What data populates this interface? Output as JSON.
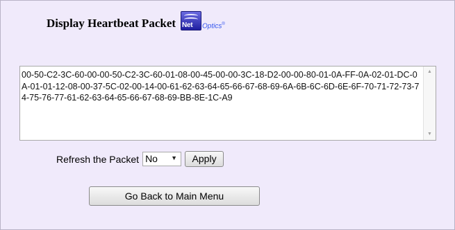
{
  "header": {
    "title": "Display Heartbeat Packet",
    "logo": {
      "mark_text": "Net",
      "tagline": "Optics",
      "registered": "®",
      "brand_color": "#2a2ab8"
    }
  },
  "packet": {
    "hex": "00-50-C2-3C-60-00-00-50-C2-3C-60-01-08-00-45-00-00-3C-18-D2-00-00-80-01-0A-FF-0A-02-01-DC-0A-01-01-12-08-00-37-5C-02-00-14-00-61-62-63-64-65-66-67-68-69-6A-6B-6C-6D-6E-6F-70-71-72-73-74-75-76-77-61-62-63-64-65-66-67-68-69-BB-8E-1C-A9"
  },
  "refresh": {
    "label": "Refresh the Packet",
    "selected": "No",
    "apply_label": "Apply"
  },
  "back_label": "Go Back to Main Menu",
  "colors": {
    "background": "#f0eafb",
    "box_border": "#a9a9a9"
  }
}
